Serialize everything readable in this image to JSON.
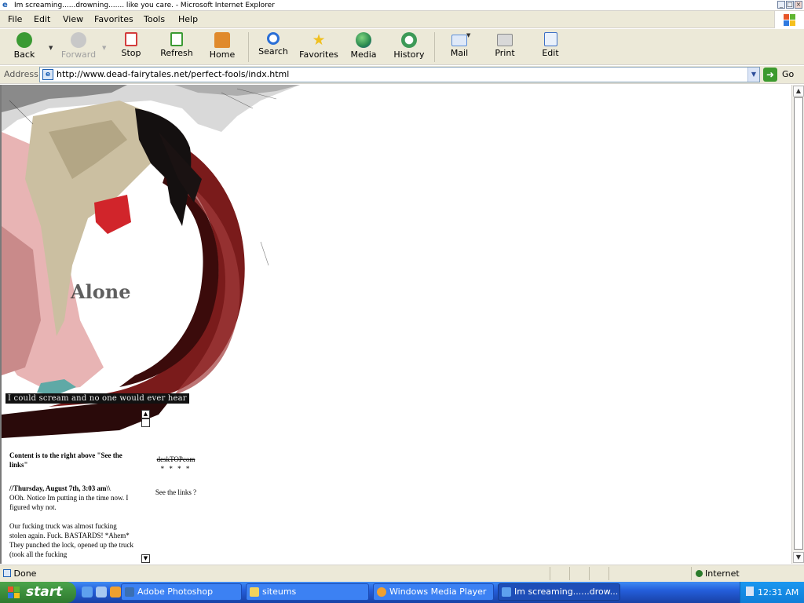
{
  "window": {
    "title": "Im screaming......drowning....... like you care. - Microsoft Internet Explorer",
    "controls": [
      "_",
      "□",
      "×"
    ]
  },
  "menu": [
    "File",
    "Edit",
    "View",
    "Favorites",
    "Tools",
    "Help"
  ],
  "toolbar": {
    "buttons": [
      {
        "label": "Back",
        "icon": "back-arrow-icon",
        "color": "#3b9a33"
      },
      {
        "label": "Forward",
        "icon": "forward-arrow-icon",
        "color": "#b0b0b0",
        "disabled": true
      },
      {
        "label": "Stop",
        "icon": "stop-icon",
        "color": "#d33c3c"
      },
      {
        "label": "Refresh",
        "icon": "refresh-icon",
        "color": "#3b9a33"
      },
      {
        "label": "Home",
        "icon": "home-icon",
        "color": "#e08a2c"
      },
      {
        "label": "Search",
        "icon": "search-icon",
        "color": "#2b6fd6"
      },
      {
        "label": "Favorites",
        "icon": "star-icon",
        "color": "#f0c020"
      },
      {
        "label": "Media",
        "icon": "media-globe-icon",
        "color": "#2a8a4f"
      },
      {
        "label": "History",
        "icon": "history-icon",
        "color": "#3d9a57"
      },
      {
        "label": "Mail",
        "icon": "mail-icon",
        "color": "#5d8fd9"
      },
      {
        "label": "Print",
        "icon": "printer-icon",
        "color": "#8a8a8a"
      },
      {
        "label": "Edit",
        "icon": "edit-page-icon",
        "color": "#3c6fc5"
      }
    ]
  },
  "address": {
    "label": "Address",
    "url": "http://www.dead-fairytales.net/perfect-fools/indx.html",
    "go_label": "Go"
  },
  "page": {
    "art_word": "Alone",
    "caption": "I could scream and no one would ever hear",
    "left_column": {
      "intro": "Content is to the right above \"See the links\"",
      "entry_date": "//Thursday, August 7th, 3:03 am\\\\",
      "para1": "OOh. Notice Im putting in the time now. I figured why not.",
      "para2": "Our fucking truck was almost fucking stolen again. Fuck. BASTARDS! *Ahem* They punched the lock, opened up the truck (took all the fucking"
    },
    "right_column": {
      "credit": "deskTOPcom",
      "separator": "* * * *",
      "links": "See the links ?"
    }
  },
  "status": {
    "text": "Done",
    "zone": "Internet"
  },
  "taskbar": {
    "start": "start",
    "tasks": [
      {
        "label": "Adobe Photoshop",
        "active": false
      },
      {
        "label": "siteums",
        "active": false
      },
      {
        "label": "Windows Media Player",
        "active": false
      },
      {
        "label": "Im screaming......drow...",
        "active": true
      }
    ],
    "clock": "12:31 AM"
  }
}
